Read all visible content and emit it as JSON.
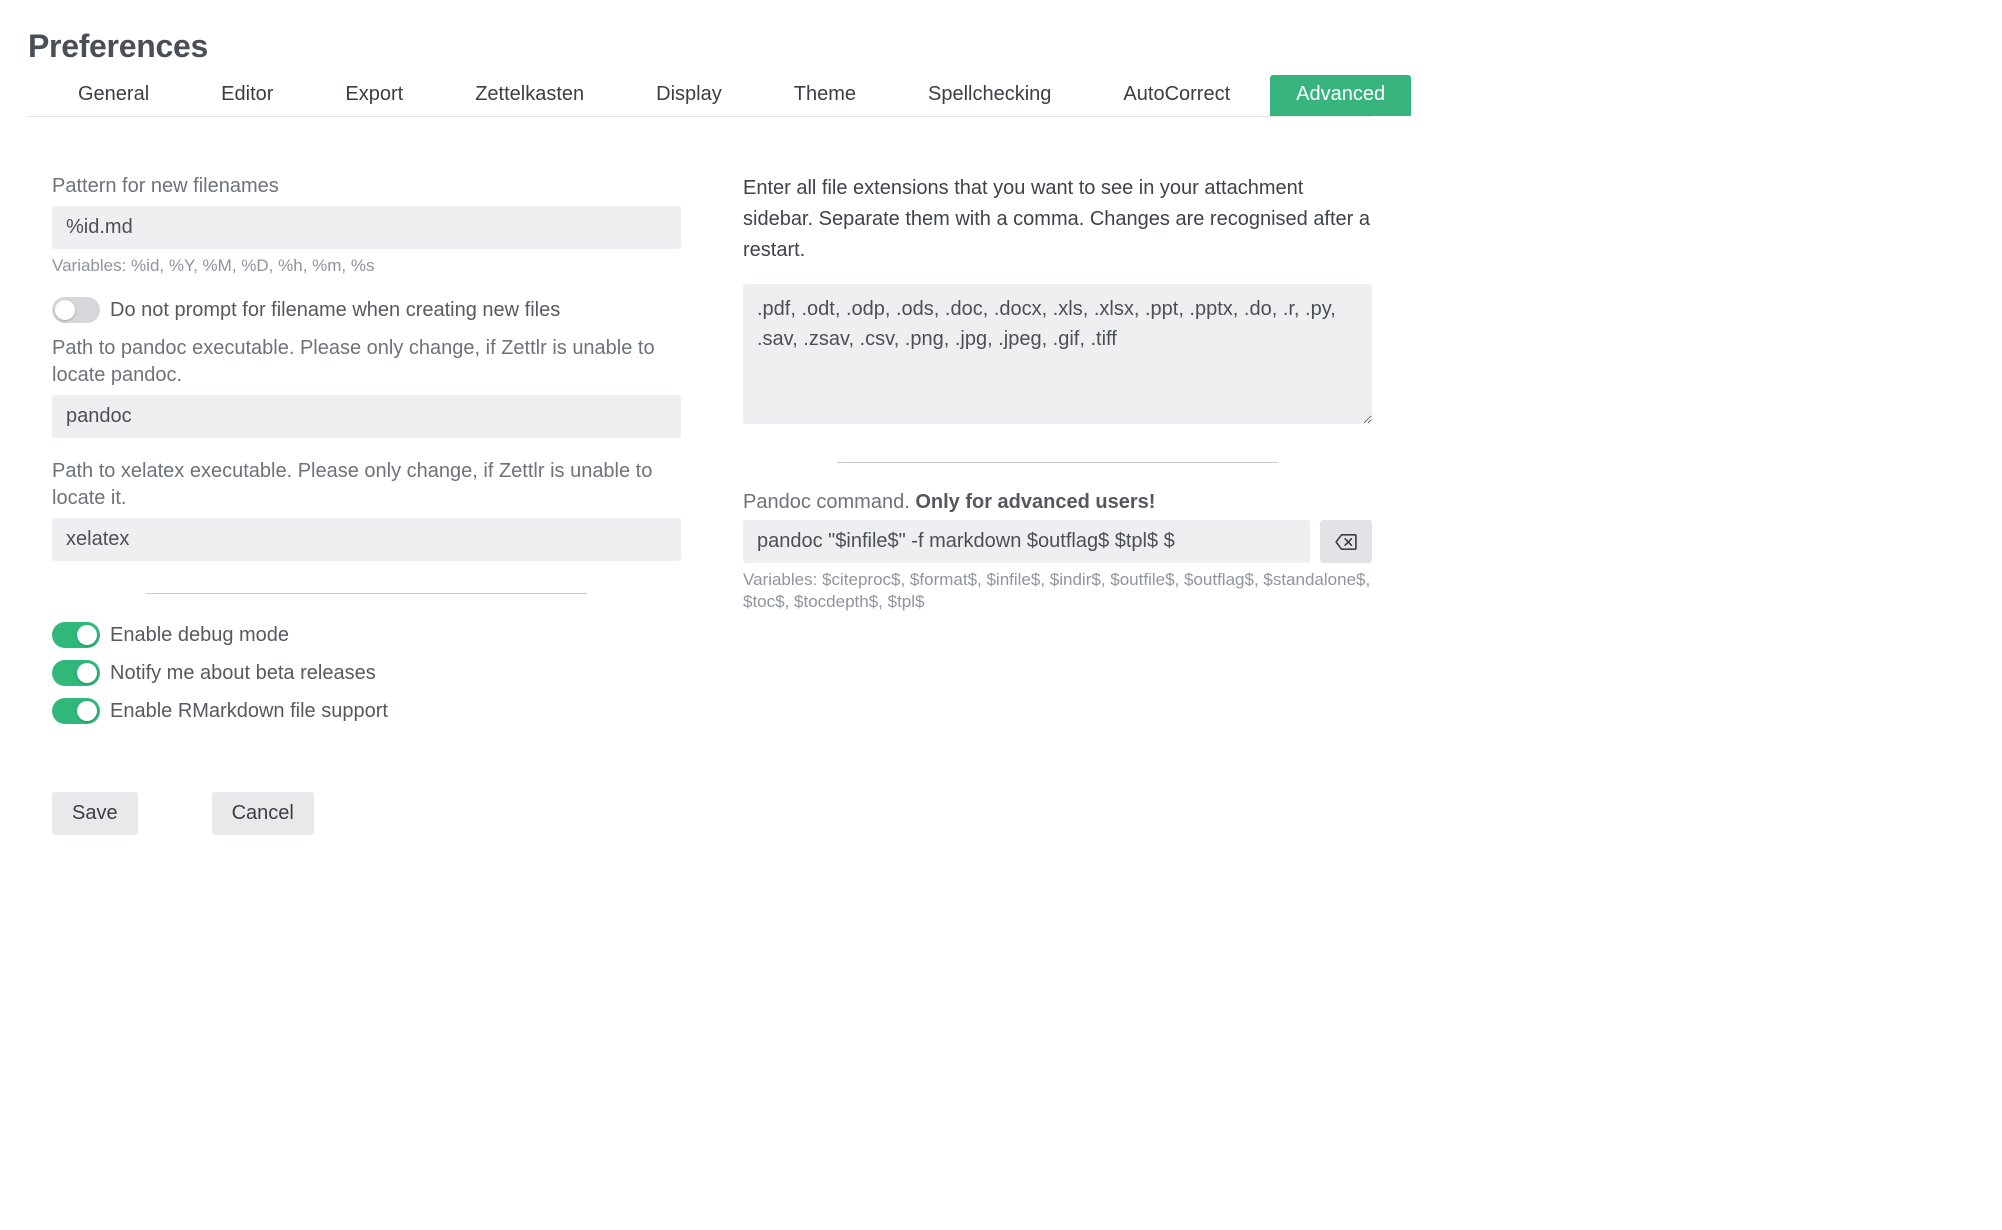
{
  "title": "Preferences",
  "tabs": [
    {
      "label": "General",
      "active": false
    },
    {
      "label": "Editor",
      "active": false
    },
    {
      "label": "Export",
      "active": false
    },
    {
      "label": "Zettelkasten",
      "active": false
    },
    {
      "label": "Display",
      "active": false
    },
    {
      "label": "Theme",
      "active": false
    },
    {
      "label": "Spellchecking",
      "active": false
    },
    {
      "label": "AutoCorrect",
      "active": false
    },
    {
      "label": "Advanced",
      "active": true
    }
  ],
  "left": {
    "pattern_label": "Pattern for new filenames",
    "pattern_value": "%id.md",
    "pattern_hint": "Variables: %id, %Y, %M, %D, %h, %m, %s",
    "toggle_no_prompt": {
      "label": "Do not prompt for filename when creating new files",
      "on": false
    },
    "pandoc_path_label": "Path to pandoc executable. Please only change, if Zettlr is unable to locate pandoc.",
    "pandoc_path_value": "pandoc",
    "xelatex_path_label": "Path to xelatex executable. Please only change, if Zettlr is unable to locate it.",
    "xelatex_path_value": "xelatex",
    "toggle_debug": {
      "label": "Enable debug mode",
      "on": true
    },
    "toggle_beta": {
      "label": "Notify me about beta releases",
      "on": true
    },
    "toggle_rmarkdown": {
      "label": "Enable RMarkdown file support",
      "on": true
    }
  },
  "right": {
    "extensions_desc": "Enter all file extensions that you want to see in your attachment sidebar. Separate them with a comma. Changes are recognised after a restart.",
    "extensions_value": ".pdf, .odt, .odp, .ods, .doc, .docx, .xls, .xlsx, .ppt, .pptx, .do, .r, .py, .sav, .zsav, .csv, .png, .jpg, .jpeg, .gif, .tiff",
    "pandoc_cmd_label_pre": "Pandoc command. ",
    "pandoc_cmd_label_strong": "Only for advanced users!",
    "pandoc_cmd_value": "pandoc \"$infile$\" -f markdown $outflag$ $tpl$ $",
    "pandoc_cmd_hint": "Variables: $citeproc$, $format$, $infile$, $indir$, $outfile$, $outflag$, $standalone$, $toc$, $tocdepth$, $tpl$"
  },
  "buttons": {
    "save": "Save",
    "cancel": "Cancel"
  }
}
